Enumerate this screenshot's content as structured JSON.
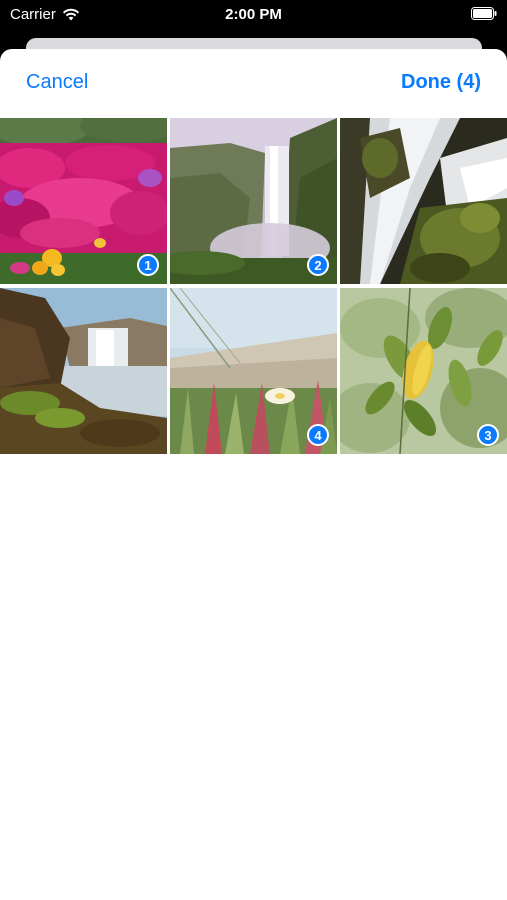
{
  "status_bar": {
    "carrier": "Carrier",
    "time": "2:00 PM",
    "icons": [
      "wifi-icon",
      "battery-icon"
    ]
  },
  "nav": {
    "cancel_label": "Cancel",
    "done_label": "Done (4)"
  },
  "colors": {
    "accent": "#0a7aff",
    "sheet_background": "#ffffff",
    "status_bar_background": "#000000"
  },
  "photos": [
    {
      "subject": "pink flowers",
      "selected": true,
      "selection_index": "1"
    },
    {
      "subject": "waterfall in valley",
      "selected": true,
      "selection_index": "2"
    },
    {
      "subject": "waterfall over mossy rocks",
      "selected": false,
      "selection_index": ""
    },
    {
      "subject": "waterfall at coast",
      "selected": false,
      "selection_index": ""
    },
    {
      "subject": "white flower in grass",
      "selected": true,
      "selection_index": "4"
    },
    {
      "subject": "green leaves",
      "selected": true,
      "selection_index": "3"
    }
  ]
}
